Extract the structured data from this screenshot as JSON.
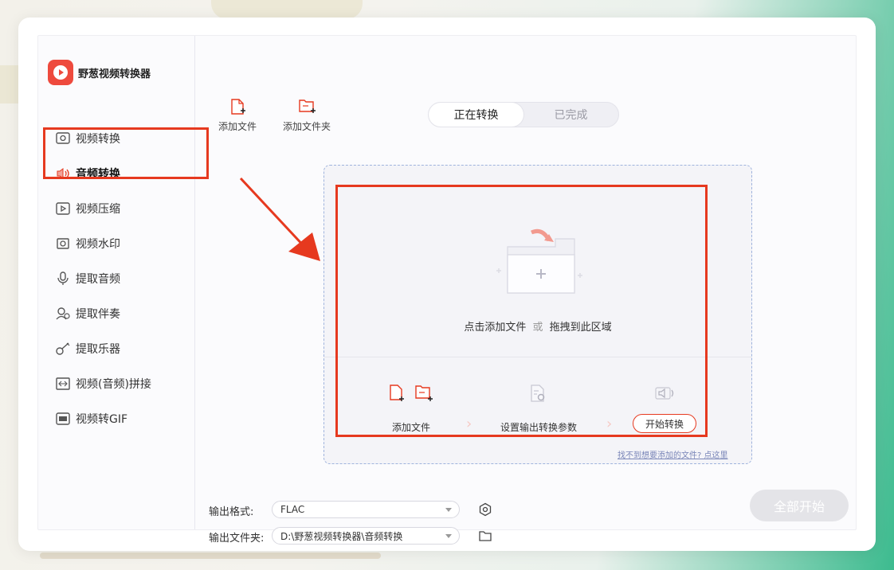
{
  "app": {
    "title": "野葱视频转换器"
  },
  "sidebar": {
    "items": [
      {
        "label": "视频转换",
        "icon": "video-convert-icon"
      },
      {
        "label": "音频转换",
        "icon": "audio-convert-icon",
        "active": true
      },
      {
        "label": "视频压缩",
        "icon": "video-compress-icon"
      },
      {
        "label": "视频水印",
        "icon": "watermark-icon"
      },
      {
        "label": "提取音频",
        "icon": "extract-audio-icon"
      },
      {
        "label": "提取伴奏",
        "icon": "extract-accompaniment-icon"
      },
      {
        "label": "提取乐器",
        "icon": "guitar-icon"
      },
      {
        "label": "视频(音频)拼接",
        "icon": "merge-icon"
      },
      {
        "label": "视频转GIF",
        "icon": "gif-icon"
      }
    ]
  },
  "toolbar": {
    "add_file": "添加文件",
    "add_folder": "添加文件夹"
  },
  "tabs": {
    "converting": "正在转换",
    "completed": "已完成"
  },
  "dropzone": {
    "hint_main": "点击添加文件",
    "hint_or": "或",
    "hint_drag": "拖拽到此区域",
    "step1": "添加文件",
    "step2": "设置输出转换参数",
    "step3": "开始转换",
    "help_link": "找不到想要添加的文件? 点这里"
  },
  "footer": {
    "format_label": "输出格式:",
    "format_value": "FLAC",
    "folder_label": "输出文件夹:",
    "folder_value": "D:\\野葱视频转换器\\音频转换",
    "start_all": "全部开始"
  },
  "colors": {
    "accent": "#e6391f",
    "brand": "#ee4a3d",
    "annotation": "#e6391f"
  }
}
